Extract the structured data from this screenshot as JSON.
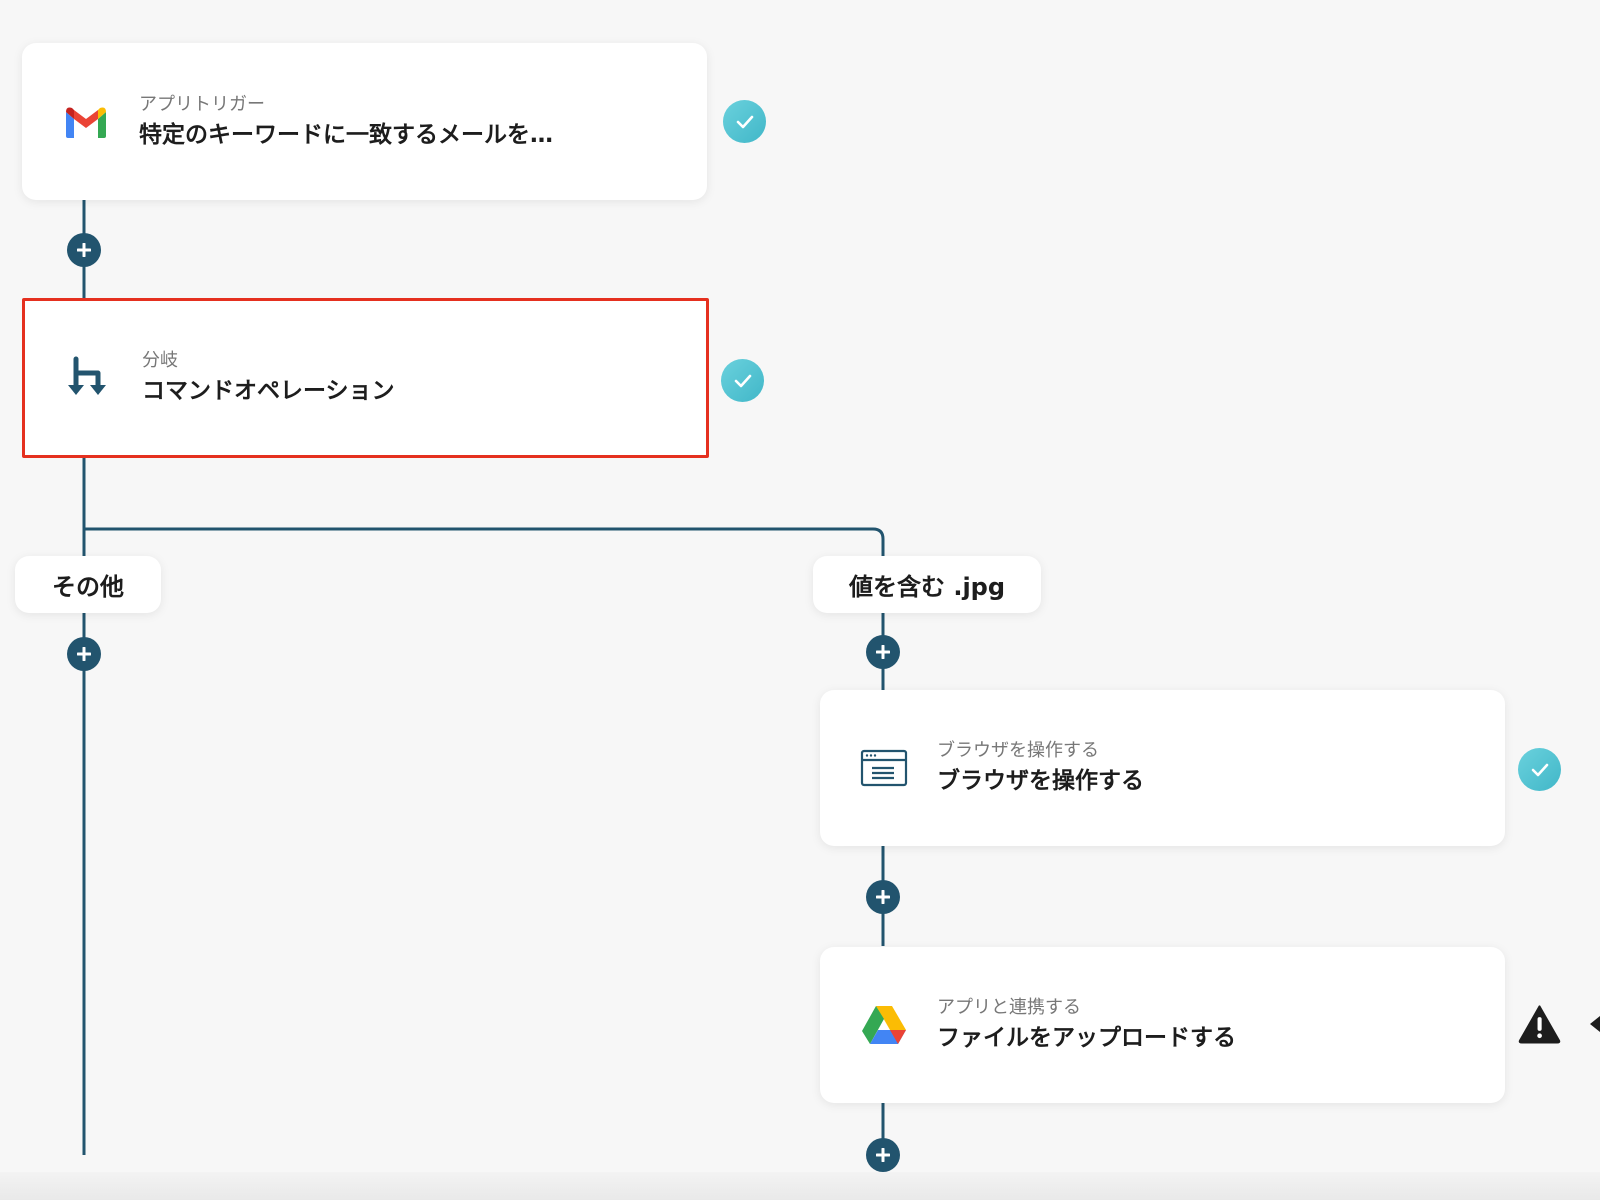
{
  "nodes": {
    "trigger": {
      "kind": "アプリトリガー",
      "title": "特定のキーワードに一致するメールを…",
      "icon": "gmail-icon",
      "status": "complete"
    },
    "branch": {
      "kind": "分岐",
      "title": "コマンドオペレーション",
      "icon": "branch-icon",
      "status": "complete",
      "selected": true
    },
    "browser": {
      "kind": "ブラウザを操作する",
      "title": "ブラウザを操作する",
      "icon": "browser-window-icon",
      "status": "complete"
    },
    "drive": {
      "kind": "アプリと連携する",
      "title": "ファイルをアップロードする",
      "icon": "google-drive-icon",
      "status": "warning"
    }
  },
  "branches": {
    "other": {
      "label": "その他"
    },
    "contains": {
      "label": "値を含む .jpg"
    }
  },
  "colors": {
    "connector": "#22546e",
    "selected_border": "#e5301f",
    "status_ok": "#4fc1cf",
    "status_warning": "#1d1d1d"
  }
}
